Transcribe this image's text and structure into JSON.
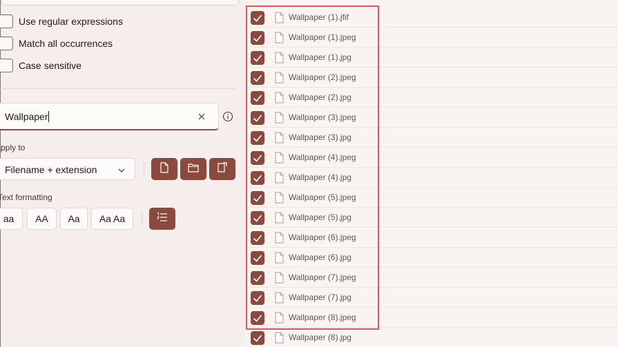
{
  "options": [
    {
      "label": "Use regular expressions",
      "checked": false
    },
    {
      "label": "Match all occurrences",
      "checked": false
    },
    {
      "label": "Case sensitive",
      "checked": false
    }
  ],
  "search": {
    "value": "Wallpaper"
  },
  "apply_to": {
    "label": "Apply to",
    "selected": "Filename + extension"
  },
  "text_formatting": {
    "label": "Text formatting",
    "buttons": [
      "aa",
      "AA",
      "Aa",
      "Aa Aa"
    ]
  },
  "files": [
    "Wallpaper (1).jfif",
    "Wallpaper (1).jpeg",
    "Wallpaper (1).jpg",
    "Wallpaper (2).jpeg",
    "Wallpaper (2).jpg",
    "Wallpaper (3).jpeg",
    "Wallpaper (3).jpg",
    "Wallpaper (4).jpeg",
    "Wallpaper (4).jpg",
    "Wallpaper (5).jpeg",
    "Wallpaper (5).jpg",
    "Wallpaper (6).jpeg",
    "Wallpaper (6).jpg",
    "Wallpaper (7).jpeg",
    "Wallpaper (7).jpg",
    "Wallpaper (8).jpeg",
    "Wallpaper (8).jpg"
  ],
  "colors": {
    "accent": "#8b4a3e",
    "highlight": "#e05555"
  }
}
